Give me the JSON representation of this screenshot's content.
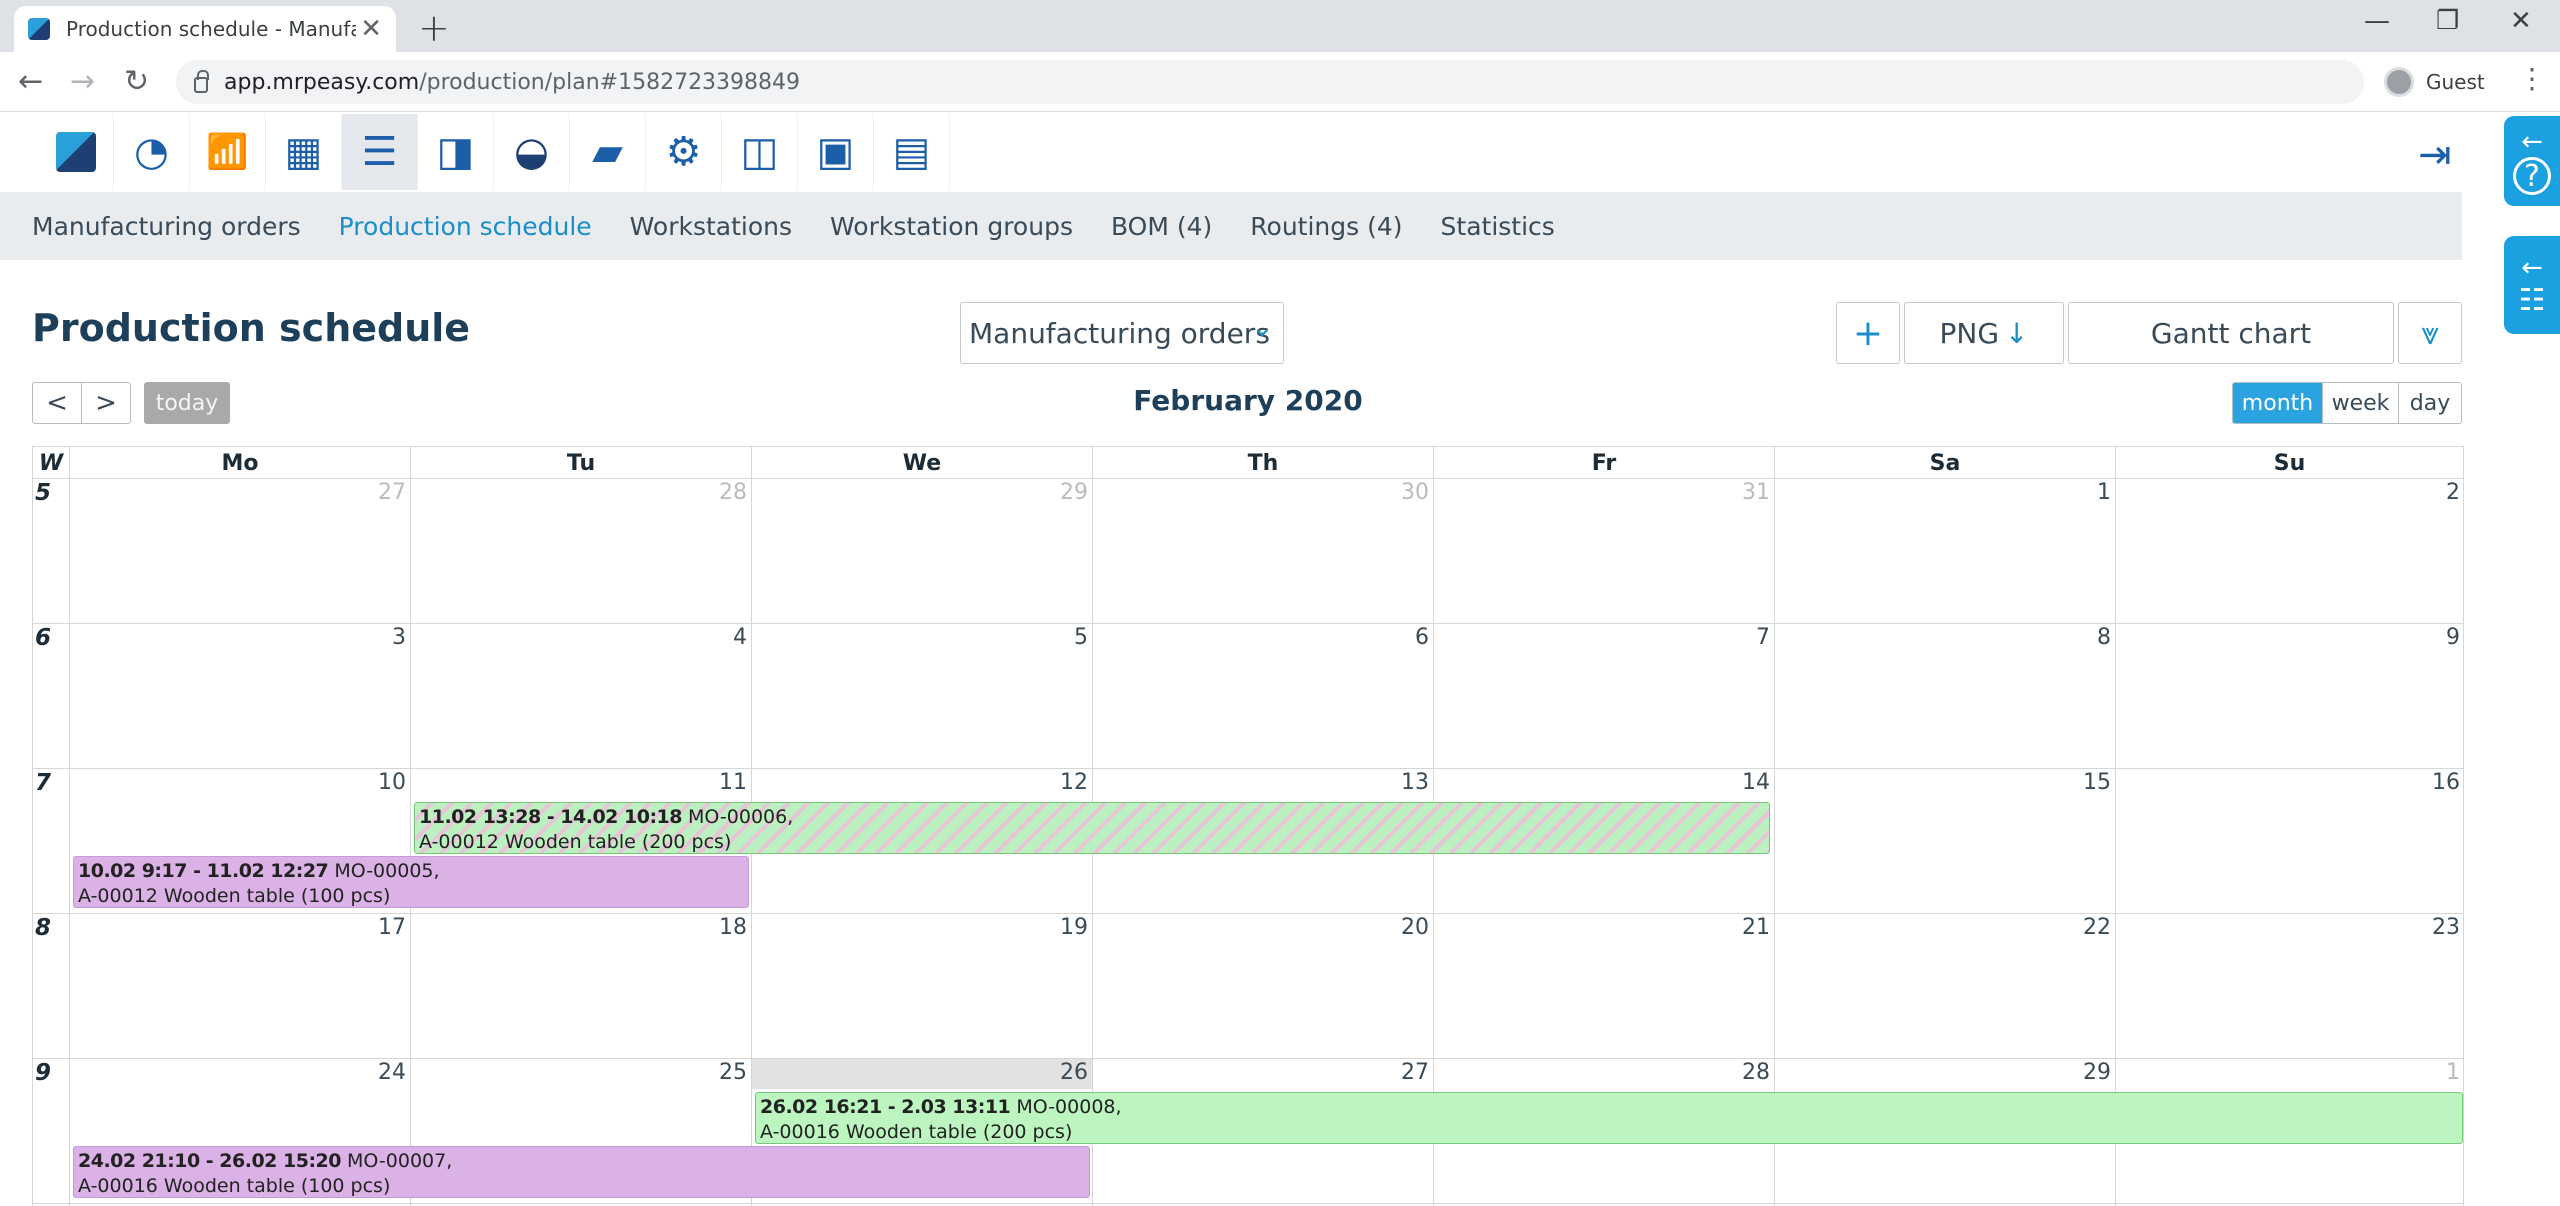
{
  "browser": {
    "tab_title": "Production schedule - Manufactu",
    "url_host": "app.mrpeasy.com",
    "url_path": "/production/plan#1582723398849",
    "profile": "Guest"
  },
  "app_icons": [
    "logo-icon",
    "dashboard-icon",
    "statistics-icon",
    "calendar-icon",
    "production-planning-icon",
    "book-icon",
    "purchasing-basket-icon",
    "folder-icon",
    "settings-icon",
    "presentation-icon",
    "gift-icon",
    "document-icon"
  ],
  "submenu": {
    "items": [
      "Manufacturing orders",
      "Production schedule",
      "Workstations",
      "Workstation groups",
      "BOM (4)",
      "Routings (4)",
      "Statistics"
    ],
    "active_index": 1
  },
  "header": {
    "title": "Production schedule",
    "dropdown_value": "Manufacturing orders",
    "add_label": "+",
    "png_label": "PNG",
    "gantt_label": "Gantt chart"
  },
  "nav": {
    "prev": "<",
    "next": ">",
    "today": "today",
    "month_title": "February 2020",
    "views": [
      "month",
      "week",
      "day"
    ],
    "active_view": "month"
  },
  "calendar": {
    "week_header": "W",
    "day_headers": [
      "Mo",
      "Tu",
      "We",
      "Th",
      "Fr",
      "Sa",
      "Su"
    ],
    "weeks": [
      {
        "number": "5",
        "days": [
          "27",
          "28",
          "29",
          "30",
          "31",
          "1",
          "2"
        ]
      },
      {
        "number": "6",
        "days": [
          "3",
          "4",
          "5",
          "6",
          "7",
          "8",
          "9"
        ]
      },
      {
        "number": "7",
        "days": [
          "10",
          "11",
          "12",
          "13",
          "14",
          "15",
          "16"
        ]
      },
      {
        "number": "8",
        "days": [
          "17",
          "18",
          "19",
          "20",
          "21",
          "22",
          "23"
        ]
      },
      {
        "number": "9",
        "days": [
          "24",
          "25",
          "26",
          "27",
          "28",
          "29",
          "1"
        ]
      }
    ],
    "events": [
      {
        "time": "11.02 13:28 - 14.02 10:18",
        "order": "MO-00006,",
        "item": "A-00012 Wooden table (200 pcs)",
        "color": "#bdf0c0"
      },
      {
        "time": "10.02 9:17 - 11.02 12:27",
        "order": "MO-00005,",
        "item": "A-00012 Wooden table (100 pcs)",
        "color": "#dbb2e5"
      },
      {
        "time": "26.02 16:21 - 2.03 13:11",
        "order": "MO-00008,",
        "item": "A-00016 Wooden table (200 pcs)",
        "color": "#bdf5c0"
      },
      {
        "time": "24.02 21:10 - 26.02 15:20",
        "order": "MO-00007,",
        "item": "A-00016 Wooden table (100 pcs)",
        "color": "#dbb2e5"
      }
    ]
  }
}
